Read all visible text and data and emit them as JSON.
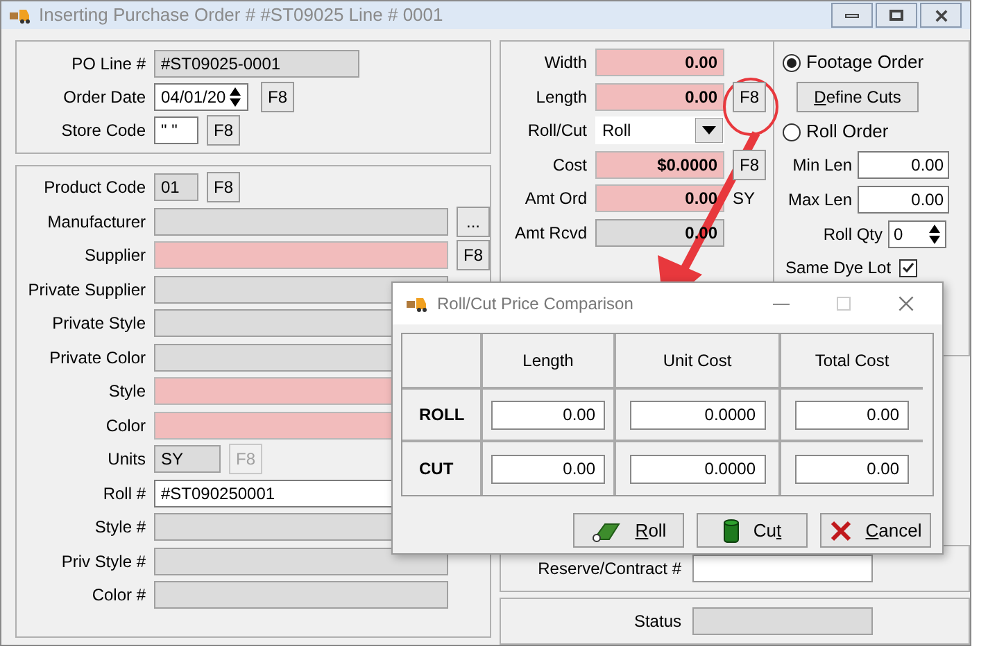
{
  "window": {
    "title": "Inserting Purchase Order # #ST09025  Line # 0001"
  },
  "header_fields": [
    {
      "label": "PO Line #",
      "value": "#ST09025-0001",
      "readonly": true,
      "required": false,
      "kind": "wide"
    },
    {
      "label": "Order Date",
      "value": "04/01/20",
      "readonly": false,
      "required": false,
      "kind": "spin",
      "button": "F8",
      "button_disabled": false
    },
    {
      "label": "Store Code",
      "value": "\" \"",
      "readonly": false,
      "required": false,
      "kind": "short",
      "button": "F8",
      "button_disabled": false
    }
  ],
  "product_fields": [
    {
      "label": "Product Code",
      "value": "01",
      "readonly": true,
      "required": false,
      "kind": "short",
      "button": "F8",
      "button_disabled": false
    },
    {
      "label": "Manufacturer",
      "readonly": true,
      "required": false,
      "kind": "long",
      "button": "...",
      "button_disabled": false
    },
    {
      "label": "Supplier",
      "readonly": false,
      "required": true,
      "kind": "long",
      "button": "F8",
      "button_disabled": false
    },
    {
      "label": "Private Supplier",
      "readonly": true,
      "required": false,
      "kind": "long"
    },
    {
      "label": "Private Style",
      "readonly": true,
      "required": false,
      "kind": "long"
    },
    {
      "label": "Private Color",
      "readonly": true,
      "required": false,
      "kind": "long"
    },
    {
      "label": "Style",
      "readonly": false,
      "required": true,
      "kind": "long"
    },
    {
      "label": "Color",
      "readonly": false,
      "required": true,
      "kind": "long"
    },
    {
      "label": "Units",
      "value": "SY",
      "readonly": true,
      "required": false,
      "kind": "units",
      "button": "F8",
      "button_disabled": true
    },
    {
      "label": "Roll #",
      "value": "#ST090250001",
      "readonly": false,
      "required": false,
      "kind": "long"
    },
    {
      "label": "Style #",
      "readonly": true,
      "required": false,
      "kind": "long"
    },
    {
      "label": "Priv Style #",
      "readonly": true,
      "required": false,
      "kind": "long"
    },
    {
      "label": "Color #",
      "readonly": true,
      "required": false,
      "kind": "long"
    }
  ],
  "dimension_fields": [
    {
      "label": "Width",
      "value": "0.00",
      "readonly": false,
      "required": true,
      "kind": "text"
    },
    {
      "label": "Length",
      "value": "0.00",
      "readonly": false,
      "required": true,
      "kind": "text",
      "button": "F8"
    },
    {
      "label": "Roll/Cut",
      "value": "Roll",
      "readonly": false,
      "required": false,
      "kind": "combo"
    },
    {
      "label": "Cost",
      "value": "$0.0000",
      "readonly": false,
      "required": true,
      "kind": "text",
      "button": "F8"
    },
    {
      "label": "Amt Ord",
      "value": "0.00",
      "readonly": false,
      "required": true,
      "kind": "text",
      "suffix": "SY"
    },
    {
      "label": "Amt Rcvd",
      "value": "0.00",
      "readonly": true,
      "required": false,
      "kind": "text"
    }
  ],
  "order_type": {
    "options": [
      {
        "label": "Footage Order",
        "selected": true
      },
      {
        "label": "Roll Order",
        "selected": false
      }
    ],
    "define_cuts": {
      "key": "D",
      "after": "efine Cuts"
    }
  },
  "length_fields": [
    {
      "label": "Min Len",
      "value": "0.00",
      "kind": "text"
    },
    {
      "label": "Max Len",
      "value": "0.00",
      "kind": "text"
    },
    {
      "label": "Roll Qty",
      "value": "0",
      "kind": "spin"
    }
  ],
  "same_dye_lot": {
    "label": "Same Dye Lot",
    "checked": true
  },
  "reserve": {
    "label": "Reserve/Contract #"
  },
  "status": {
    "label": "Status"
  },
  "dialog": {
    "title": "Roll/Cut Price Comparison",
    "columns": [
      "Length",
      "Unit Cost",
      "Total Cost"
    ],
    "rows": [
      {
        "label": "ROLL",
        "cells": [
          "0.00",
          "0.0000",
          "0.00"
        ]
      },
      {
        "label": "CUT",
        "cells": [
          "0.00",
          "0.0000",
          "0.00"
        ]
      }
    ],
    "buttons": [
      {
        "kind": "roll",
        "key": "R",
        "after": "oll"
      },
      {
        "kind": "cut",
        "before": "Cu",
        "key": "t"
      },
      {
        "kind": "cancel",
        "key": "C",
        "after": "ancel"
      }
    ]
  }
}
